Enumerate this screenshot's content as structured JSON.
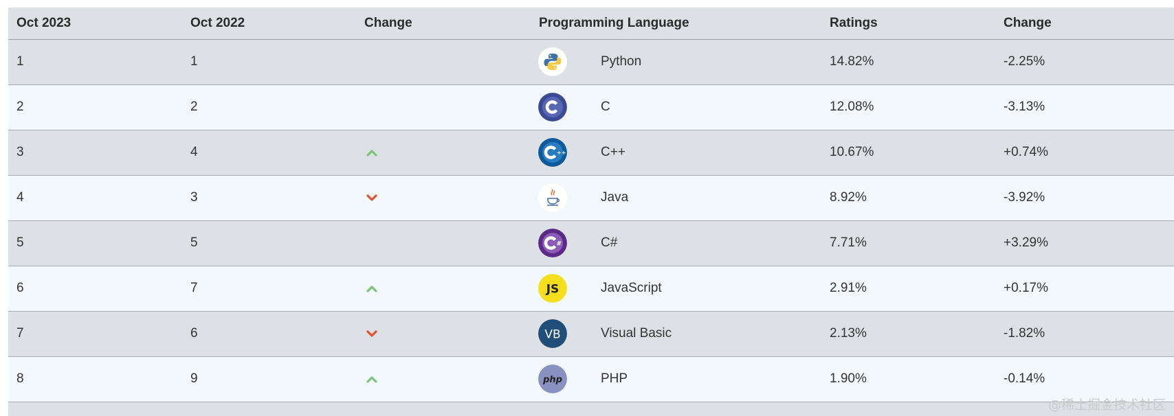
{
  "table": {
    "headers": [
      "Oct 2023",
      "Oct 2022",
      "Change",
      "Programming Language",
      "Ratings",
      "Change"
    ],
    "rows": [
      {
        "rank_now": "1",
        "rank_prev": "1",
        "trend": "none",
        "language": "Python",
        "logo": "python-logo",
        "rating": "14.82%",
        "change": "-2.25%"
      },
      {
        "rank_now": "2",
        "rank_prev": "2",
        "trend": "none",
        "language": "C",
        "logo": "c-logo",
        "rating": "12.08%",
        "change": "-3.13%"
      },
      {
        "rank_now": "3",
        "rank_prev": "4",
        "trend": "up",
        "language": "C++",
        "logo": "cpp-logo",
        "rating": "10.67%",
        "change": "+0.74%"
      },
      {
        "rank_now": "4",
        "rank_prev": "3",
        "trend": "down",
        "language": "Java",
        "logo": "java-logo",
        "rating": "8.92%",
        "change": "-3.92%"
      },
      {
        "rank_now": "5",
        "rank_prev": "5",
        "trend": "none",
        "language": "C#",
        "logo": "csharp-logo",
        "rating": "7.71%",
        "change": "+3.29%"
      },
      {
        "rank_now": "6",
        "rank_prev": "7",
        "trend": "up",
        "language": "JavaScript",
        "logo": "javascript-logo",
        "rating": "2.91%",
        "change": "+0.17%"
      },
      {
        "rank_now": "7",
        "rank_prev": "6",
        "trend": "down",
        "language": "Visual Basic",
        "logo": "visual-basic-logo",
        "rating": "2.13%",
        "change": "-1.82%"
      },
      {
        "rank_now": "8",
        "rank_prev": "9",
        "trend": "up",
        "language": "PHP",
        "logo": "php-logo",
        "rating": "1.90%",
        "change": "-0.14%"
      }
    ]
  },
  "colors": {
    "row_dark": "#dde1e5",
    "row_light": "#f3f8fc",
    "arrow_up": "#7cc576",
    "arrow_down": "#e2522c"
  },
  "watermark": "@稀土掘金技术社区"
}
